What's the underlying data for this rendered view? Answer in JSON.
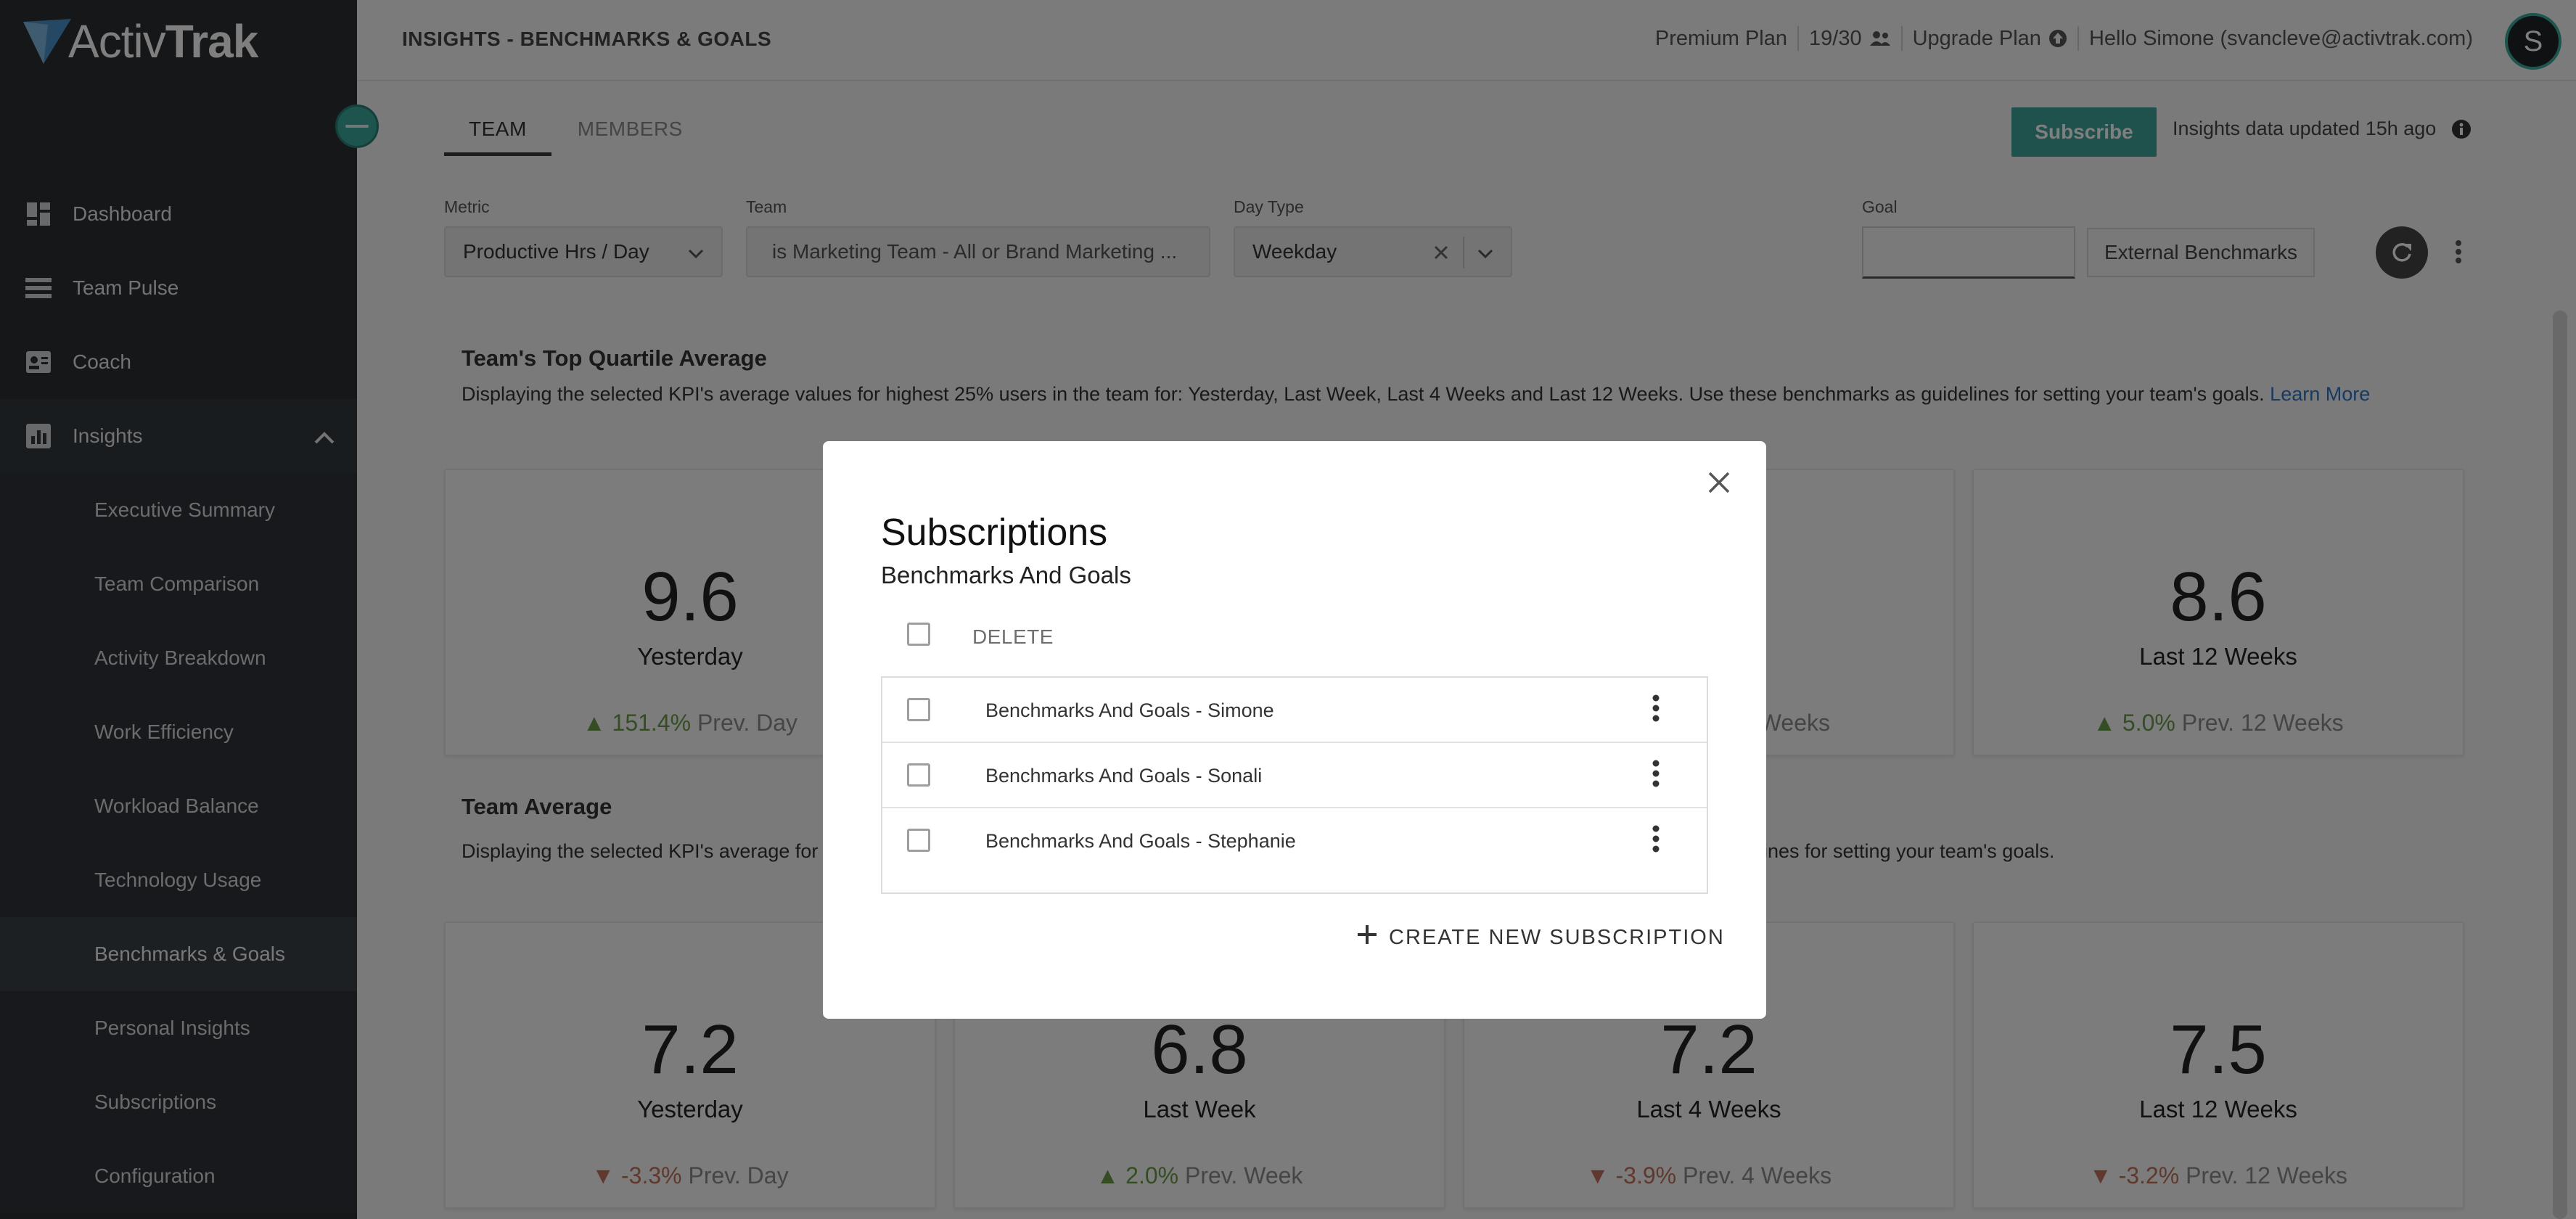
{
  "app": {
    "logo_text_a": "Activ",
    "logo_text_b": "Trak"
  },
  "sidebar": {
    "items": [
      {
        "label": "Dashboard",
        "icon": "dashboard-icon"
      },
      {
        "label": "Team Pulse",
        "icon": "team-pulse-icon"
      },
      {
        "label": "Coach",
        "icon": "coach-icon"
      },
      {
        "label": "Insights",
        "icon": "insights-icon"
      }
    ],
    "insights_sub": [
      "Executive Summary",
      "Team Comparison",
      "Activity Breakdown",
      "Work Efficiency",
      "Workload Balance",
      "Technology Usage",
      "Benchmarks & Goals",
      "Personal Insights",
      "Subscriptions",
      "Configuration"
    ],
    "active_sub": "Benchmarks & Goals"
  },
  "header": {
    "title": "INSIGHTS - BENCHMARKS & GOALS",
    "plan": "Premium Plan",
    "seats": "19/30",
    "upgrade": "Upgrade Plan",
    "greeting": "Hello Simone (svancleve@activtrak.com)",
    "avatar_letter": "S"
  },
  "tabs": {
    "team": "TEAM",
    "members": "MEMBERS"
  },
  "toolbar": {
    "subscribe": "Subscribe",
    "updated": "Insights data updated 15h ago"
  },
  "filters": {
    "metric_label": "Metric",
    "metric_value": "Productive Hrs / Day",
    "team_label": "Team",
    "team_value": "is Marketing Team - All or Brand Marketing ...",
    "daytype_label": "Day Type",
    "daytype_value": "Weekday",
    "goal_label": "Goal",
    "goal_value": "",
    "external_benchmarks": "External Benchmarks"
  },
  "top_quartile": {
    "title": "Team's Top Quartile Average",
    "desc": "Displaying the selected KPI's average values for highest 25% users in the team for: Yesterday, Last Week, Last 4 Weeks and Last 12 Weeks. Use these benchmarks as guidelines for setting your team's goals.",
    "learn_more": "Learn More",
    "cards": [
      {
        "value": "9.6",
        "label": "Yesterday",
        "change": "151.4%",
        "prev": "Prev. Day",
        "dir": "up"
      },
      {
        "value": "",
        "label": "",
        "change": "",
        "prev": "",
        "dir": "up"
      },
      {
        "value": "",
        "label": "s",
        "change": "",
        "prev": "Weeks",
        "dir": "none"
      },
      {
        "value": "8.6",
        "label": "Last 12 Weeks",
        "change": "5.0%",
        "prev": "Prev. 12 Weeks",
        "dir": "up"
      }
    ]
  },
  "team_average": {
    "title": "Team Average",
    "desc_left": "Displaying the selected KPI's average for al",
    "desc_right": "lines for setting your team's goals.",
    "cards": [
      {
        "value": "7.2",
        "label": "Yesterday",
        "change": "-3.3%",
        "prev": "Prev. Day",
        "dir": "down"
      },
      {
        "value": "6.8",
        "label": "Last Week",
        "change": "2.0%",
        "prev": "Prev. Week",
        "dir": "up"
      },
      {
        "value": "7.2",
        "label": "Last 4 Weeks",
        "change": "-3.9%",
        "prev": "Prev. 4 Weeks",
        "dir": "down"
      },
      {
        "value": "7.5",
        "label": "Last 12 Weeks",
        "change": "-3.2%",
        "prev": "Prev. 12 Weeks",
        "dir": "down"
      }
    ]
  },
  "modal": {
    "title": "Subscriptions",
    "subtitle": "Benchmarks And Goals",
    "delete": "DELETE",
    "rows": [
      "Benchmarks And Goals - Simone",
      "Benchmarks And Goals - Sonali",
      "Benchmarks And Goals - Stephanie"
    ],
    "create_new": "CREATE NEW SUBSCRIPTION"
  },
  "colors": {
    "sidebar_bg": "#2b2f33",
    "accent": "#3fa39a",
    "up": "#6a9a4a",
    "down": "#c0705a",
    "link": "#2f74c0"
  }
}
